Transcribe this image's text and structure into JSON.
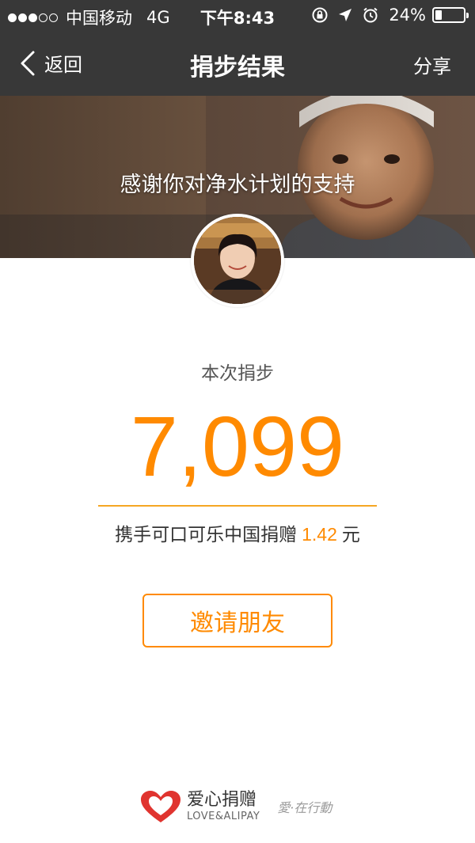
{
  "status_bar": {
    "carrier": "中国移动",
    "network": "4G",
    "time": "下午8:43",
    "battery_percent": "24%",
    "battery_level": 0.24,
    "signal_bars": 3,
    "icons": [
      "rotation-lock-icon",
      "location-arrow-icon",
      "alarm-icon",
      "battery-icon"
    ]
  },
  "nav": {
    "back_label": "返回",
    "title": "捐步结果",
    "share_label": "分享"
  },
  "banner": {
    "message": "感谢你对净水计划的支持"
  },
  "result": {
    "label": "本次捐步",
    "steps": "7,099",
    "donation_prefix": "携手可口可乐中国捐赠",
    "donation_amount": "1.42",
    "donation_unit": "元"
  },
  "actions": {
    "invite_label": "邀请朋友"
  },
  "footer": {
    "brand_cn": "爱心捐赠",
    "brand_en": "LOVE&ALIPAY",
    "slogan": "愛·在行動"
  },
  "colors": {
    "accent": "#ff8a00",
    "bar_bg": "#383838"
  }
}
